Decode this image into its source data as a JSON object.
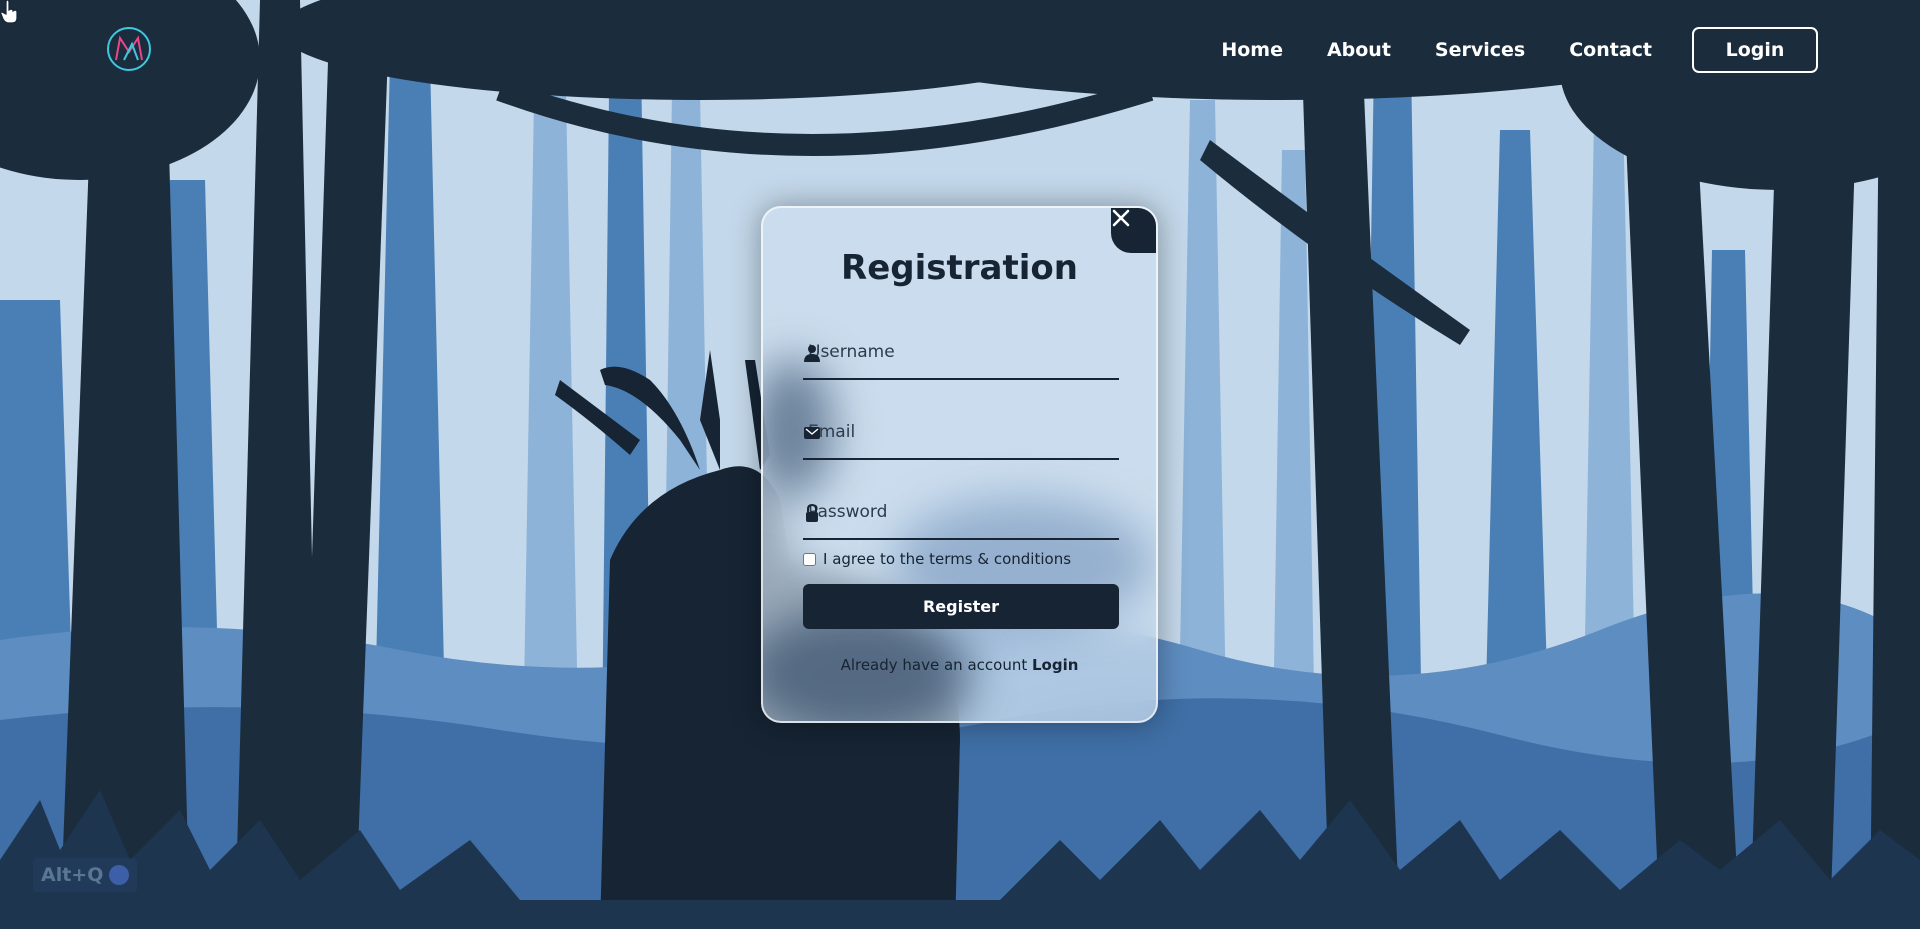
{
  "header": {
    "logo_name": "ml-monogram-logo",
    "nav": [
      "Home",
      "About",
      "Services",
      "Contact"
    ],
    "login_label": "Login"
  },
  "modal": {
    "title": "Registration",
    "fields": [
      {
        "placeholder": "Username",
        "icon": "user-icon"
      },
      {
        "placeholder": "Email",
        "icon": "mail-icon"
      },
      {
        "placeholder": "Password",
        "icon": "lock-icon"
      }
    ],
    "agree_label": "I agree to the terms & conditions",
    "register_label": "Register",
    "switch_text": "Already have an account",
    "switch_link": "Login",
    "close_icon": "close-icon"
  },
  "overlay": {
    "hotkey_label": "Alt+Q"
  },
  "colors": {
    "sky": "#c3d8ea",
    "dark": "#162433",
    "mid_blue": "#4a7fb5",
    "light_blue": "#8bb1d6"
  }
}
